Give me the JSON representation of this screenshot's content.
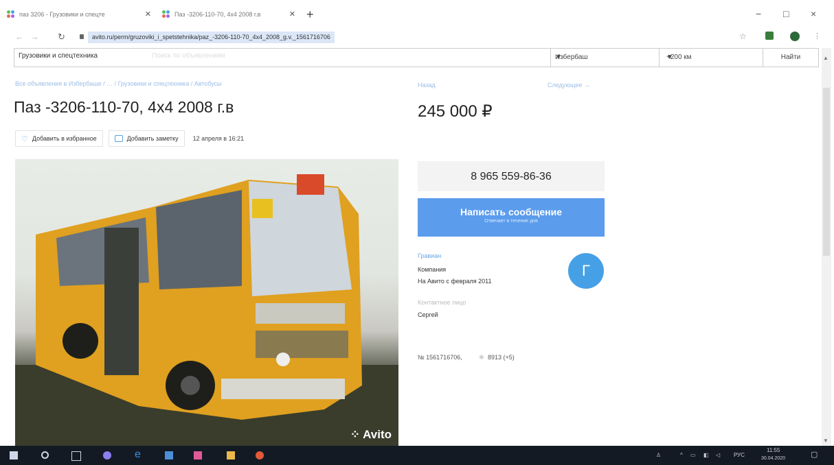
{
  "tabs": [
    {
      "label": "паз 3206 - Грузовики и спецте"
    },
    {
      "label": "Паз -3206-110-70, 4x4 2008 г.в"
    }
  ],
  "window": {
    "new_tab": "+",
    "minimize": "−",
    "restore": "□",
    "close": "×"
  },
  "address": {
    "url": "avito.ru/perm/gruzoviki_i_spetstehnika/paz_-3206-110-70_4x4_2008_g.v._1561716706"
  },
  "search": {
    "category": "Грузовики и спецтехника",
    "placeholder": "Поиск по объявлениям",
    "location": "Избербаш",
    "radius": "+200 км",
    "find_label": "Найти"
  },
  "breadcrumbs": "Все объявления в Избербаше / … / Грузовики и спецтехника / Автобусы",
  "listing": {
    "title": "Паз -3206-110-70, 4x4 2008 г.в",
    "back": "Назад",
    "next": "Следующее →",
    "price": "245 000 ₽",
    "add_favorite": "Добавить в избранное",
    "add_note": "Добавить заметку",
    "date": "12 апреля в 16:21",
    "watermark": "Avito"
  },
  "contact": {
    "phone": "8 965 559-86-36",
    "message_label": "Написать сообщение",
    "message_sub": "Отвечает в течение дня",
    "seller_name": "Гравиан",
    "seller_type": "Компания",
    "seller_since": "На Авито с февраля 2011",
    "contact_person_label": "Контактное лицо",
    "contact_person": "Сергей",
    "avatar_letter": "Г",
    "listing_number": "№ 1561716706,",
    "views": "8913 (+5)"
  },
  "taskbar": {
    "lang": "РУС",
    "time": "11:55",
    "date": "30.04.2020"
  },
  "colors": {
    "accent": "#5b9cec",
    "link": "#9bbde6",
    "avatar": "#46a0e6",
    "taskbar": "#141a24"
  }
}
